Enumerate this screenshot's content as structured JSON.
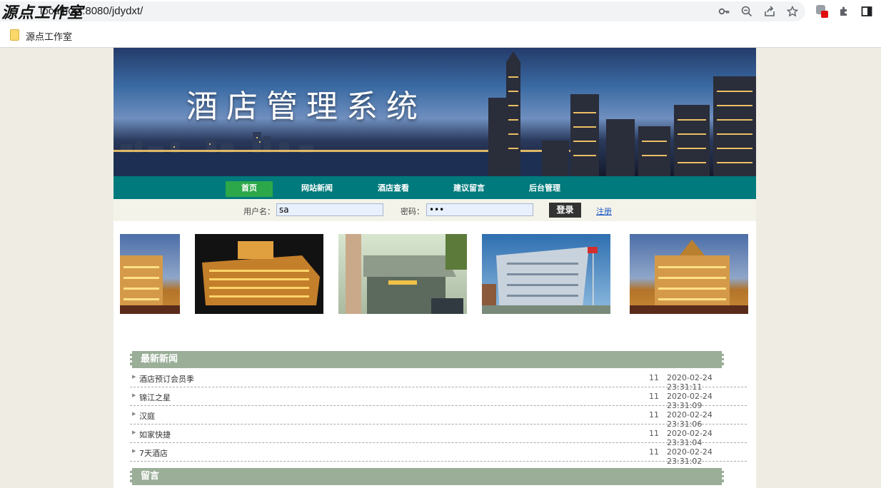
{
  "browser": {
    "url": "localhost:8080/jdydxt/",
    "watermark": "源点工作室",
    "bookmark_label": "源点工作室"
  },
  "banner": {
    "title": "酒店管理系统"
  },
  "nav": {
    "items": [
      "首页",
      "网站新闻",
      "酒店查看",
      "建议留言",
      "后台管理"
    ]
  },
  "login": {
    "username_label": "用户名：",
    "username_value": "sa",
    "password_label": "密码：",
    "password_value": "•••",
    "login_button": "登录",
    "register_link": "注册"
  },
  "news": {
    "heading": "最新新闻",
    "rows": [
      {
        "title": "酒店预订会员季",
        "hits": "11",
        "date": "2020-02-24 23:31:11"
      },
      {
        "title": "锦江之星",
        "hits": "11",
        "date": "2020-02-24 23:31:09"
      },
      {
        "title": "汉庭",
        "hits": "11",
        "date": "2020-02-24 23:31:06"
      },
      {
        "title": "如家快捷",
        "hits": "11",
        "date": "2020-02-24 23:31:04"
      },
      {
        "title": "7天酒店",
        "hits": "11",
        "date": "2020-02-24 23:31:02"
      }
    ]
  },
  "message": {
    "heading": "留言"
  }
}
